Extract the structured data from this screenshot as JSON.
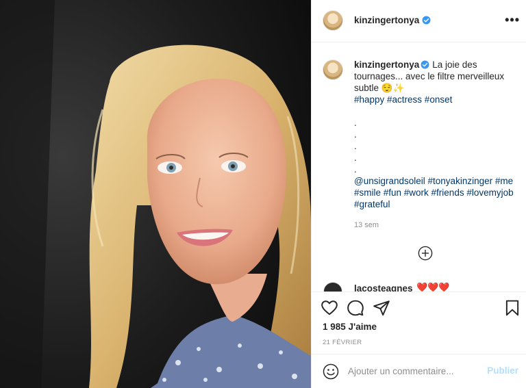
{
  "post": {
    "author": "kinzingertonya",
    "more_label": "•••"
  },
  "caption": {
    "username": "kinzingertonya",
    "text": "La joie des tournages... avec le filtre merveilleux subtle",
    "emoji": "😌✨",
    "hashtags_line1": "#happy #actress #onset",
    "dots": [
      ".",
      ".",
      ".",
      ".",
      "."
    ],
    "mention": "@unsigrandsoleil",
    "tags_line2": "#tonyakinzinger #me",
    "tags_line3": "#smile #fun #work #friends #lovemyjob",
    "tags_line4": "#grateful",
    "time": "13 sem"
  },
  "next_comment": {
    "username": "lacosteagnes",
    "emoji": "❤️❤️❤️"
  },
  "stats": {
    "likes": "1 985 J'aime",
    "date": "21 FÉVRIER"
  },
  "comment_box": {
    "placeholder": "Ajouter un commentaire...",
    "publish_label": "Publier"
  },
  "colors": {
    "hashtag": "#00376b",
    "verified": "#3897f0",
    "publish_disabled": "#b2dffc",
    "muted": "#8e8e8e"
  },
  "icons": [
    "verified-badge-icon",
    "more-options-icon",
    "load-more-comments-icon",
    "heart-icon",
    "comment-icon",
    "share-icon",
    "bookmark-icon",
    "emoji-icon"
  ]
}
